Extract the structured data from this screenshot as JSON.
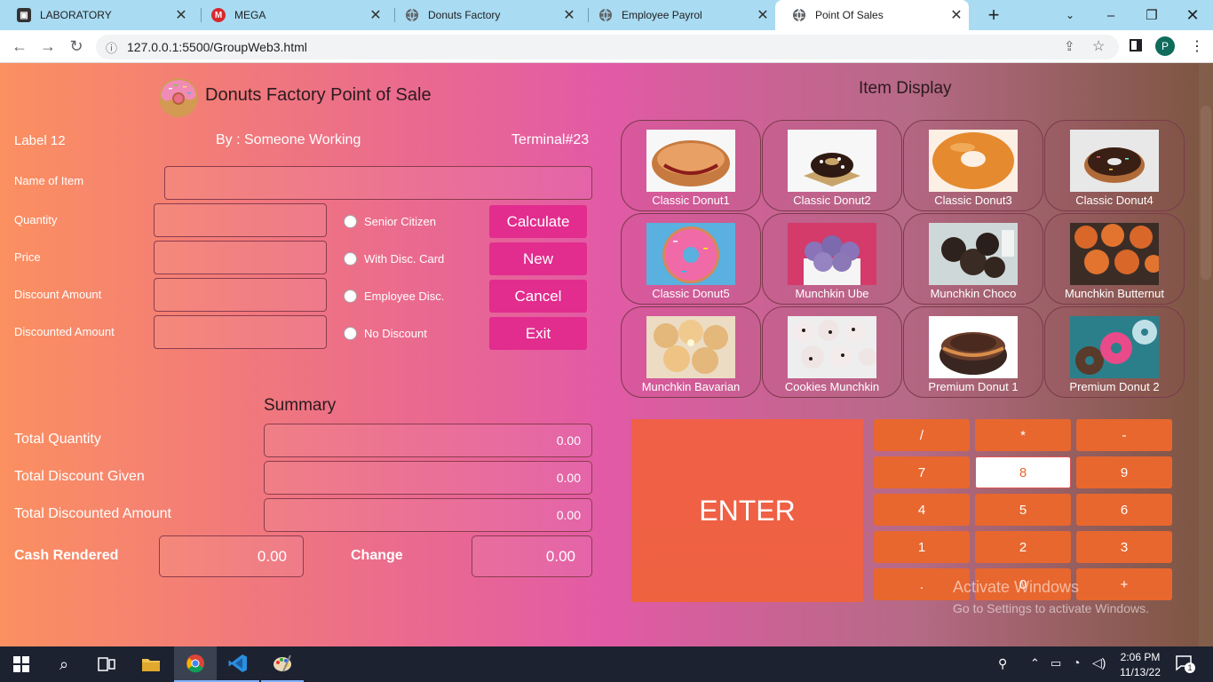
{
  "browser": {
    "tabs": [
      {
        "title": "LABORATORY",
        "icon": "laboratory-favicon"
      },
      {
        "title": "MEGA",
        "icon": "mega-favicon"
      },
      {
        "title": "Donuts Factory",
        "icon": "globe-icon"
      },
      {
        "title": "Employee Payrol",
        "icon": "globe-icon"
      },
      {
        "title": "Point Of Sales",
        "icon": "globe-icon",
        "active": true
      }
    ],
    "url": "127.0.0.1:5500/GroupWeb3.html",
    "profile_initial": "P"
  },
  "pos": {
    "title": "Donuts Factory Point of Sale",
    "label": "Label 12",
    "by": "By : Someone Working",
    "terminal": "Terminal#23",
    "fields": {
      "name_of_item": "Name of Item",
      "quantity": "Quantity",
      "price": "Price",
      "discount_amount": "Discount Amount",
      "discounted_amount": "Discounted Amount"
    },
    "discount_options": [
      "Senior Citizen",
      "With Disc. Card",
      "Employee Disc.",
      "No Discount"
    ],
    "buttons": {
      "calculate": "Calculate",
      "new": "New",
      "cancel": "Cancel",
      "exit": "Exit"
    },
    "summary": {
      "heading": "Summary",
      "total_quantity_label": "Total Quantity",
      "total_quantity": "0.00",
      "total_discount_label": "Total Discount Given",
      "total_discount": "0.00",
      "total_discounted_label": "Total Discounted Amount",
      "total_discounted": "0.00",
      "cash_label": "Cash Rendered",
      "cash": "0.00",
      "change_label": "Change",
      "change": "0.00"
    }
  },
  "item_display": {
    "heading": "Item Display",
    "items": [
      "Classic Donut1",
      "Classic Donut2",
      "Classic Donut3",
      "Classic Donut4",
      "Classic Donut5",
      "Munchkin Ube",
      "Munchkin Choco",
      "Munchkin Butternut",
      "Munchkin Bavarian",
      "Cookies Munchkin",
      "Premium Donut 1",
      "Premium Donut 2"
    ]
  },
  "keypad": {
    "enter": "ENTER",
    "keys": [
      "/",
      "*",
      "-",
      "7",
      "8",
      "9",
      "4",
      "5",
      "6",
      "1",
      "2",
      "3",
      ".",
      "0",
      "+"
    ]
  },
  "watermark": {
    "line1": "Activate Windows",
    "line2": "Go to Settings to activate Windows."
  },
  "taskbar": {
    "time": "2:06 PM",
    "date": "11/13/22",
    "notifications": "1"
  }
}
